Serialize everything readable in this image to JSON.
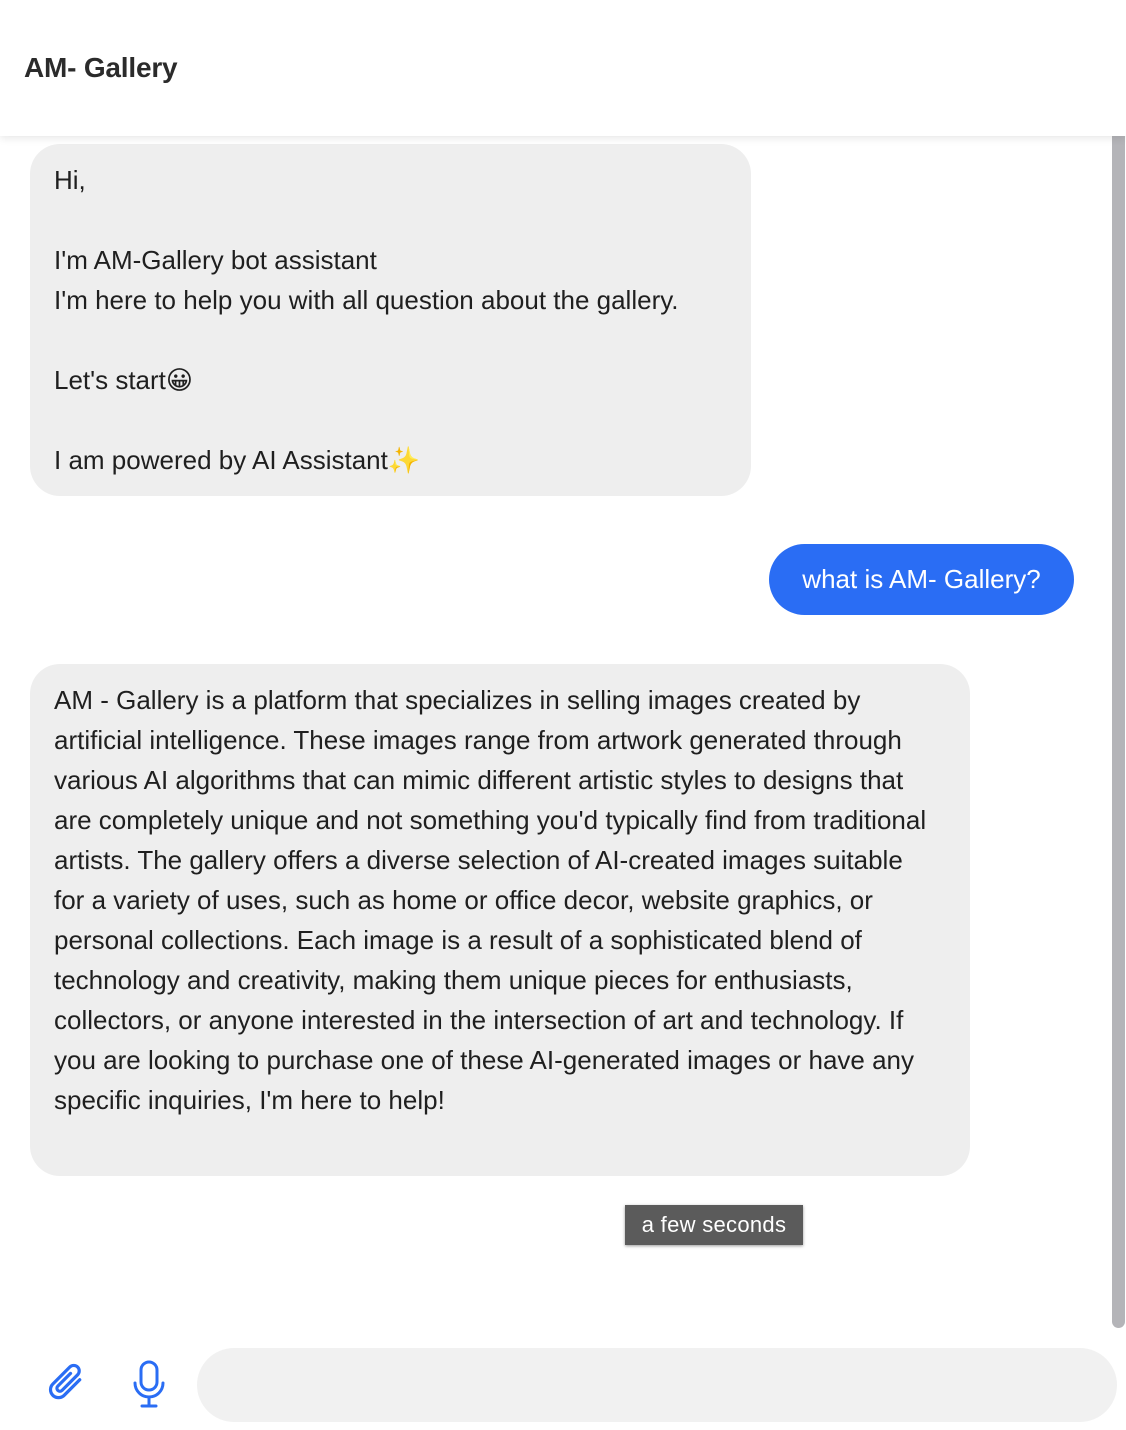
{
  "header": {
    "title": "AM- Gallery"
  },
  "messages": {
    "welcome": {
      "line1": "Hi,",
      "line2": "",
      "line3": "I'm AM-Gallery bot assistant",
      "line4": "I'm here to help you with all question about the gallery.",
      "line5": "",
      "line6": "Let's start😀",
      "line7": "",
      "line8": "I am powered by AI Assistant✨"
    },
    "user_question": "what is AM- Gallery?",
    "bot_answer": "AM - Gallery is a platform that specializes in selling images created by artificial intelligence. These images range from artwork generated through various AI algorithms that can mimic different artistic styles to designs that are completely unique and not something you'd typically find from traditional artists. The gallery offers a diverse selection of AI-created images suitable for a variety of uses, such as home or office decor, website graphics, or personal collections. Each image is a result of a sophisticated blend of technology and creativity, making them unique pieces for enthusiasts, collectors, or anyone interested in the intersection of art and technology. If you are looking to purchase one of these AI-generated images or have any specific inquiries, I'm here to help!",
    "timestamp": "a few seconds"
  },
  "composer": {
    "input_value": "",
    "input_placeholder": "",
    "attach_icon": "paperclip-icon",
    "mic_icon": "microphone-icon"
  },
  "colors": {
    "user_bubble": "#2a6df4",
    "bot_bubble": "#eeeeee",
    "icon_accent": "#2a6df4",
    "timestamp_bg": "#5b5b5b"
  }
}
